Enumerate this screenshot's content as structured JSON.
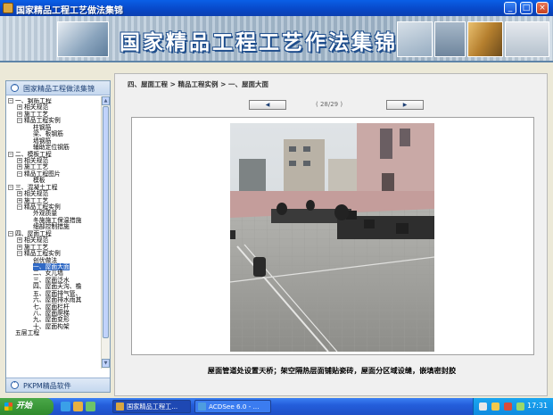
{
  "window": {
    "title": "国家精品工程工艺做法集锦",
    "minimize": "_",
    "maximize": "□",
    "close": "×"
  },
  "banner": {
    "title": "国家精品工程工艺作法集锦"
  },
  "sidebar": {
    "header_label": "国家精品工程做法集锦",
    "footer_label": "PKPM精品软件",
    "tree": [
      {
        "indent": 0,
        "exp": "−",
        "label": "一、钢筋工程"
      },
      {
        "indent": 1,
        "exp": "+",
        "label": "相关规范"
      },
      {
        "indent": 1,
        "exp": "+",
        "label": "施工工艺"
      },
      {
        "indent": 1,
        "exp": "−",
        "label": "精品工程实例"
      },
      {
        "indent": 2,
        "exp": "",
        "label": "柱钢筋"
      },
      {
        "indent": 2,
        "exp": "",
        "label": "梁、板钢筋"
      },
      {
        "indent": 2,
        "exp": "",
        "label": "墙钢筋"
      },
      {
        "indent": 2,
        "exp": "",
        "label": "辅助定位钢筋"
      },
      {
        "indent": 0,
        "exp": "−",
        "label": "二、模板工程"
      },
      {
        "indent": 1,
        "exp": "+",
        "label": "相关规范"
      },
      {
        "indent": 1,
        "exp": "+",
        "label": "施工工艺"
      },
      {
        "indent": 1,
        "exp": "−",
        "label": "精品工程图片"
      },
      {
        "indent": 2,
        "exp": "",
        "label": "模板"
      },
      {
        "indent": 0,
        "exp": "−",
        "label": "三、混凝土工程"
      },
      {
        "indent": 1,
        "exp": "+",
        "label": "相关规范"
      },
      {
        "indent": 1,
        "exp": "+",
        "label": "施工工艺"
      },
      {
        "indent": 1,
        "exp": "−",
        "label": "精品工程实例"
      },
      {
        "indent": 2,
        "exp": "",
        "label": "外观质量"
      },
      {
        "indent": 2,
        "exp": "",
        "label": "冬施施工保温措施"
      },
      {
        "indent": 2,
        "exp": "",
        "label": "细部控制措施"
      },
      {
        "indent": 0,
        "exp": "−",
        "label": "四、屋面工程"
      },
      {
        "indent": 1,
        "exp": "+",
        "label": "相关规范"
      },
      {
        "indent": 1,
        "exp": "+",
        "label": "施工工艺"
      },
      {
        "indent": 1,
        "exp": "−",
        "label": "精品工程实例"
      },
      {
        "indent": 2,
        "exp": "",
        "label": "创优做法"
      },
      {
        "indent": 2,
        "exp": "",
        "label": "一、屋面大面",
        "selected": true
      },
      {
        "indent": 2,
        "exp": "",
        "label": "二、女儿墙"
      },
      {
        "indent": 2,
        "exp": "",
        "label": "三、屋面泛水"
      },
      {
        "indent": 2,
        "exp": "",
        "label": "四、屋面天沟、檐"
      },
      {
        "indent": 2,
        "exp": "",
        "label": "五、屋面排气管、"
      },
      {
        "indent": 2,
        "exp": "",
        "label": "六、屋面排水雨其"
      },
      {
        "indent": 2,
        "exp": "",
        "label": "七、屋面栏杆"
      },
      {
        "indent": 2,
        "exp": "",
        "label": "八、屋面爬梯"
      },
      {
        "indent": 2,
        "exp": "",
        "label": "九、屋面变形"
      },
      {
        "indent": 2,
        "exp": "",
        "label": "十、屋面构架"
      },
      {
        "indent": 0,
        "exp": "",
        "label": "五层工程"
      }
    ]
  },
  "content": {
    "breadcrumb": "四、屋面工程 > 精品工程实例 > 一、屋面大面",
    "prev_button": "◀",
    "next_button": "▶",
    "page_indicator": "( 28/29 )",
    "caption": "屋面管道处设置天桥；架空隔热层面铺贴瓷砖，屋面分区域设缝，嵌填密封胶"
  },
  "taskbar": {
    "start_label": "开始",
    "tasks": [
      {
        "label": "国家精品工程工...",
        "active": true
      },
      {
        "label": "ACDSee 6.0 - ...",
        "active": false
      }
    ],
    "clock": "17:31"
  },
  "colors": {
    "accent": "#316ac5",
    "titlebar": "#0847c7",
    "taskbar": "#245edb"
  }
}
